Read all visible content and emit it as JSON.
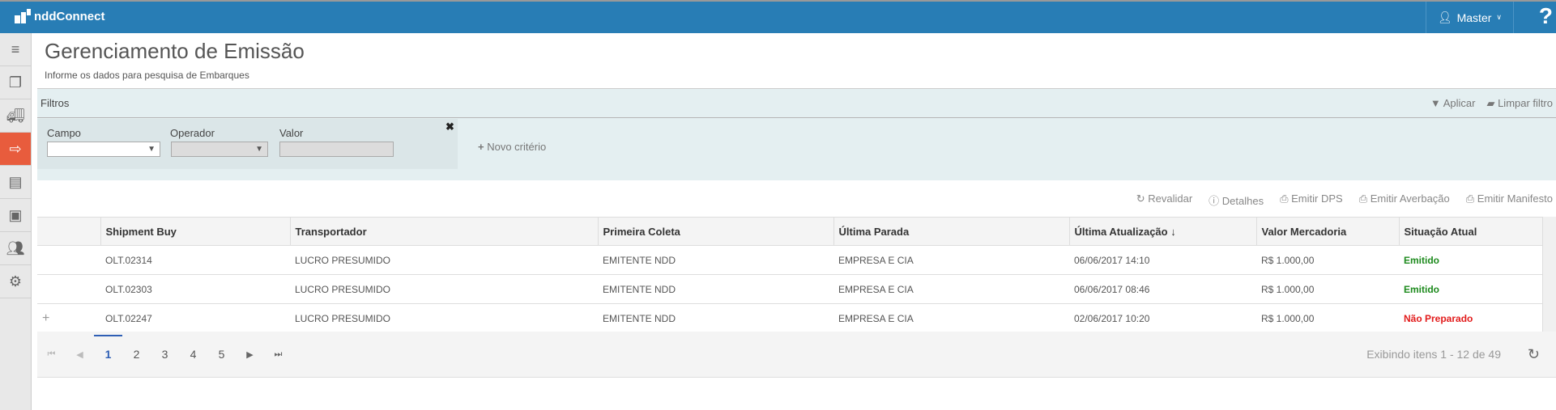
{
  "app": {
    "name": "nddConnect",
    "user": "Master",
    "help": "?"
  },
  "page": {
    "title": "Gerenciamento de Emissão",
    "subtitle": "Informe os dados para pesquisa de Embarques"
  },
  "filters": {
    "title": "Filtros",
    "apply": "Aplicar",
    "clear": "Limpar filtro",
    "campo_label": "Campo",
    "operador_label": "Operador",
    "valor_label": "Valor",
    "campo_value": "",
    "operador_value": "",
    "valor_value": "",
    "new_criterion": "Novo critério"
  },
  "actions": [
    "Revalidar",
    "Detalhes",
    "Emitir DPS",
    "Emitir Averbação",
    "Emitir Manifesto"
  ],
  "table": {
    "columns": [
      "Shipment Buy",
      "Transportador",
      "Primeira Coleta",
      "Última Parada",
      "Última Atualização ↓",
      "Valor Mercadoria",
      "Situação Atual"
    ],
    "rows": [
      [
        "OLT.02314",
        "LUCRO PRESUMIDO",
        "EMITENTE NDD",
        "EMPRESA E CIA",
        "06/06/2017 14:10",
        "R$ 1.000,00",
        "Emitido"
      ],
      [
        "OLT.02303",
        "LUCRO PRESUMIDO",
        "EMITENTE NDD",
        "EMPRESA E CIA",
        "06/06/2017 08:46",
        "R$ 1.000,00",
        "Emitido"
      ],
      [
        "OLT.02247",
        "LUCRO PRESUMIDO",
        "EMITENTE NDD",
        "EMPRESA E CIA",
        "02/06/2017 10:20",
        "R$ 1.000,00",
        "Não Preparado"
      ]
    ],
    "expand": "+"
  },
  "pager": {
    "pages": [
      "1",
      "2",
      "3",
      "4",
      "5"
    ],
    "current": "1",
    "info": "Exibindo itens 1 - 12 de 49"
  },
  "colors": {
    "header": "#287db5",
    "active": "#e85c3d",
    "ok": "#1d8a1d",
    "bad": "#e21b1b"
  }
}
